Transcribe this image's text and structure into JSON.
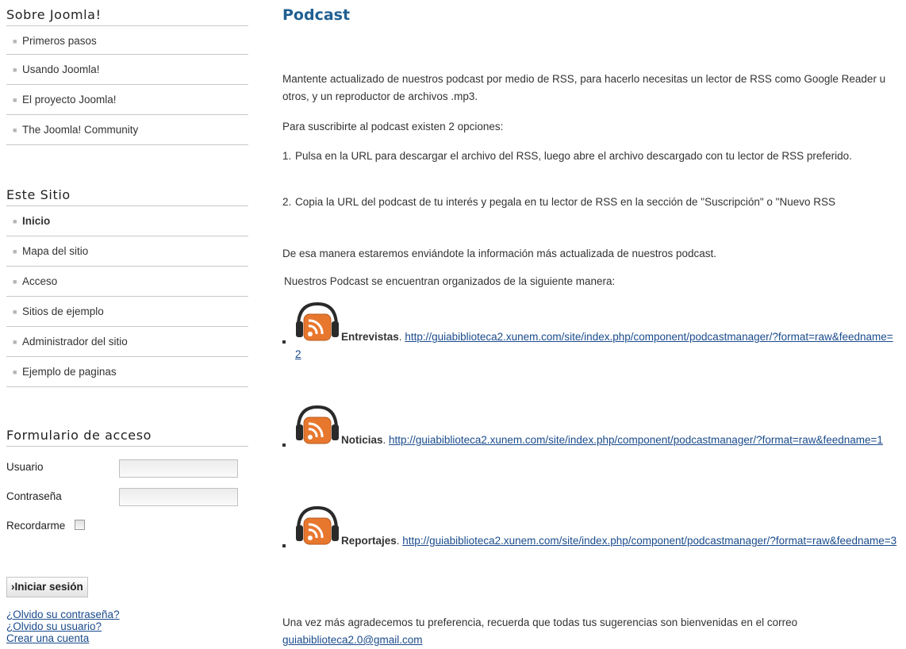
{
  "sidebar": {
    "about": {
      "title": "Sobre Joomla!",
      "items": [
        {
          "label": "Primeros pasos"
        },
        {
          "label": "Usando Joomla!"
        },
        {
          "label": "El proyecto Joomla!"
        },
        {
          "label": "The Joomla! Community"
        }
      ]
    },
    "site": {
      "title": "Este Sitio",
      "items": [
        {
          "label": "Inicio",
          "active": true
        },
        {
          "label": "Mapa del sitio"
        },
        {
          "label": "Acceso"
        },
        {
          "label": "Sitios de ejemplo"
        },
        {
          "label": "Administrador del sitio"
        },
        {
          "label": "Ejemplo de paginas"
        }
      ]
    },
    "login": {
      "title": "Formulario de acceso",
      "username_label": "Usuario",
      "username_value": "",
      "password_label": "Contraseña",
      "password_value": "",
      "remember_label": "Recordarme",
      "remember_checked": false,
      "submit_label": "›Iniciar sesión",
      "forgot_password": "¿Olvido su contraseña?",
      "forgot_username": "¿Olvido su usuario?",
      "create_account": "Crear una cuenta"
    }
  },
  "main": {
    "title": "Podcast",
    "intro": "Mantente actualizado de nuestros podcast por medio de RSS, para hacerlo necesitas un lector de RSS como Google Reader u otros, y un reproductor de archivos .mp3.",
    "options_intro": "Para suscribirte al podcast existen 2 opciones:",
    "options": [
      {
        "num": "1.",
        "text": "Pulsa en la URL para descargar el archivo del RSS, luego abre el archivo descargado con tu lector de RSS preferido."
      },
      {
        "num": "2.",
        "text": "Copia la URL del podcast de tu interés y pegala en tu lector de RSS en la sección de \"Suscripción\" o \"Nuevo RSS"
      }
    ],
    "updated_note": "De esa manera estaremos enviándote la información más actualizada de nuestros podcast.",
    "organized_note": "Nuestros Podcast se encuentran organizados de la siguiente manera:",
    "podcasts": [
      {
        "name": "Entrevistas",
        "sep": ". ",
        "url": "http://guiabiblioteca2.xunem.com/site/index.php/component/podcastmanager/?format=raw&feedname=2",
        "icon": "podcast-headphones-rss-icon"
      },
      {
        "name": "Noticias",
        "sep": ". ",
        "url": "http://guiabiblioteca2.xunem.com/site/index.php/component/podcastmanager/?format=raw&feedname=1",
        "icon": "podcast-headphones-rss-icon"
      },
      {
        "name": "Reportajes",
        "sep": ". ",
        "url": "http://guiabiblioteca2.xunem.com/site/index.php/component/podcastmanager/?format=raw&feedname=3",
        "icon": "podcast-headphones-rss-icon"
      }
    ],
    "closing": "Una vez más agradecemos tu preferencia, recuerda que todas tus sugerencias son bienvenidas en el correo",
    "email": "guiabiblioteca2.0@gmail.com"
  },
  "colors": {
    "title_blue": "#1f5f92",
    "link_blue": "#1a4b8c",
    "rss_orange": "#e8772e",
    "divider": "#c8c8c8"
  }
}
